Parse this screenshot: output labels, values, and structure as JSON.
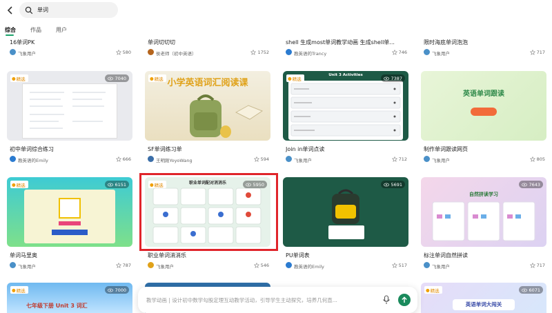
{
  "search": {
    "query": "单词"
  },
  "tabs": [
    {
      "label": "综合",
      "active": true
    },
    {
      "label": "作品",
      "active": false
    },
    {
      "label": "用户",
      "active": false
    }
  ],
  "badge_label": "精选",
  "row0": [
    {
      "title": "16单词PK",
      "author": "飞象用户",
      "likes": "580"
    },
    {
      "title": "单词切切切",
      "author": "侯老师（初中英语）",
      "likes": "1752"
    },
    {
      "title": "shell 生成most单词教学动画 生成shell单...",
      "author": "教英语的Trancy",
      "likes": "746"
    },
    {
      "title": "限时海底单词泡泡",
      "author": "飞象用户",
      "likes": "717"
    }
  ],
  "row1": [
    {
      "title": "初中单词综合练习",
      "author": "教英语的Emily",
      "likes": "666",
      "views": "7040",
      "thumb_text": ""
    },
    {
      "title": "SF单词练习单",
      "author": "王明刚YoyoWang",
      "likes": "594",
      "views": "",
      "thumb_text": "小学英语词汇阅读课"
    },
    {
      "title": "Join in单词点读",
      "author": "飞象用户",
      "likes": "712",
      "views": "7387",
      "thumb_text": "Unit 3 Activities"
    },
    {
      "title": "制作单词跟读网页",
      "author": "飞象用户",
      "likes": "805",
      "views": "",
      "thumb_text": "英语单词跟读"
    }
  ],
  "row2": [
    {
      "title": "单词马里奥",
      "author": "飞象用户",
      "likes": "787",
      "views": "6151",
      "thumb_text": ""
    },
    {
      "title": "职业单词消消乐",
      "author": "飞象用户",
      "likes": "546",
      "views": "5950",
      "thumb_text": "职业单词配对消消乐"
    },
    {
      "title": "PU单词表",
      "author": "教英语的Emily",
      "likes": "517",
      "views": "5691",
      "thumb_text": ""
    },
    {
      "title": "标注单词自然拼读",
      "author": "飞象用户",
      "likes": "717",
      "views": "7643",
      "thumb_text": "自然拼读学习"
    }
  ],
  "row3": [
    {
      "views": "7000",
      "thumb_text": "七年级下册 Unit 3 词汇"
    },
    {
      "views": "",
      "thumb_text": ""
    },
    {
      "views": "",
      "thumb_text": ""
    },
    {
      "views": "6071",
      "thumb_text": "英语单词大闯关"
    }
  ],
  "chat": {
    "placeholder": "教学动画 | 设计初中数学勾股定理互动教学活动，引导学生主动探究，培养几何直..."
  },
  "colors": {
    "accent": "#1aa36a",
    "highlight_border": "#e0242a"
  }
}
